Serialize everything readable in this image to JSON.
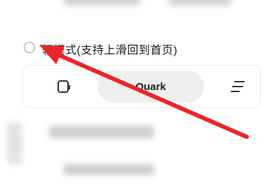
{
  "option": {
    "label": "轻模式(支持上滑回到首页)",
    "selected": false
  },
  "toolbar": {
    "center_label": "Quark",
    "left_icon": "tab-square-icon",
    "right_icon": "menu-lines-icon"
  },
  "annotation": {
    "arrow_color": "#e8262a"
  }
}
